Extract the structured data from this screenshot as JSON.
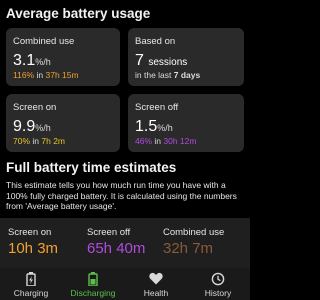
{
  "usage": {
    "title": "Average battery usage",
    "combined": {
      "label": "Combined use",
      "value": "3.1",
      "unit": "%/h",
      "pct": "116%",
      "in_text": "in",
      "time": "37h 15m"
    },
    "based_on": {
      "label": "Based on",
      "value": "7",
      "value_suffix": "sessions",
      "sub_prefix": "in the last",
      "sub_bold": "7 days"
    },
    "screen_on": {
      "label": "Screen on",
      "value": "9.9",
      "unit": "%/h",
      "pct": "70%",
      "in_text": "in",
      "time": "7h 2m"
    },
    "screen_off": {
      "label": "Screen off",
      "value": "1.5",
      "unit": "%/h",
      "pct": "46%",
      "in_text": "in",
      "time": "30h 12m"
    }
  },
  "estimates": {
    "title": "Full battery time estimates",
    "description": "This estimate tells you how much run time you have with a 100% fully charged battery. It is calculated using the numbers from 'Average battery usage'.",
    "items": [
      {
        "label": "Screen on",
        "value": "10h 3m",
        "color": "#f0a030"
      },
      {
        "label": "Screen off",
        "value": "65h 40m",
        "color": "#b04be0"
      },
      {
        "label": "Combined use",
        "value": "32h 7m",
        "color": "#8a5a3a"
      }
    ]
  },
  "nav": {
    "items": [
      {
        "label": "Charging",
        "icon": "battery-charging-icon"
      },
      {
        "label": "Discharging",
        "icon": "battery-discharging-icon",
        "active": true
      },
      {
        "label": "Health",
        "icon": "heart-icon"
      },
      {
        "label": "History",
        "icon": "history-clock-icon"
      }
    ]
  }
}
